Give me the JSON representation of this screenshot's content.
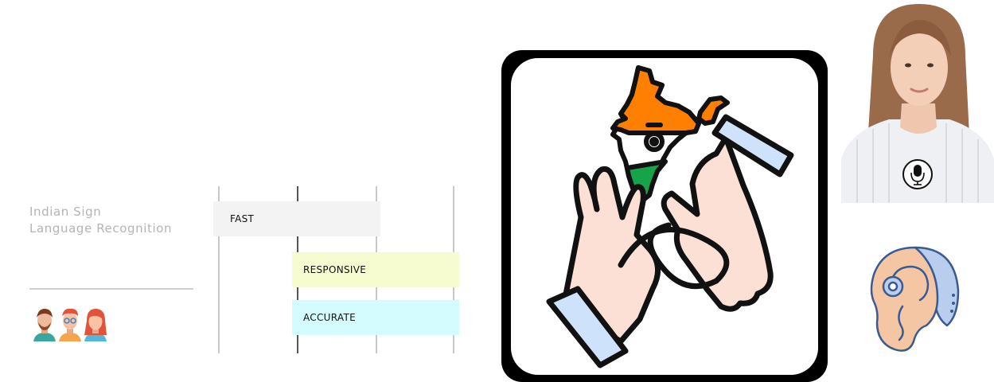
{
  "title": {
    "line1": "Indian Sign",
    "line2": "Language Recognition"
  },
  "features": [
    {
      "label": "FAST",
      "color": "#f3f3f3"
    },
    {
      "label": "RESPONSIVE",
      "color": "#f6fcd0"
    },
    {
      "label": "ACCURATE",
      "color": "#d4fbfd"
    }
  ],
  "icons": {
    "team": "people-avatars-icon",
    "main": "india-map-sign-language-hands-icon",
    "photo": "woman-with-microphone-photo",
    "mic": "microphone-icon",
    "hearing": "hearing-aid-ear-icon"
  },
  "colors": {
    "saffron": "#ff7f00",
    "green": "#16a34a",
    "skin": "#fde0d5",
    "cuff": "#cfe2fb"
  }
}
